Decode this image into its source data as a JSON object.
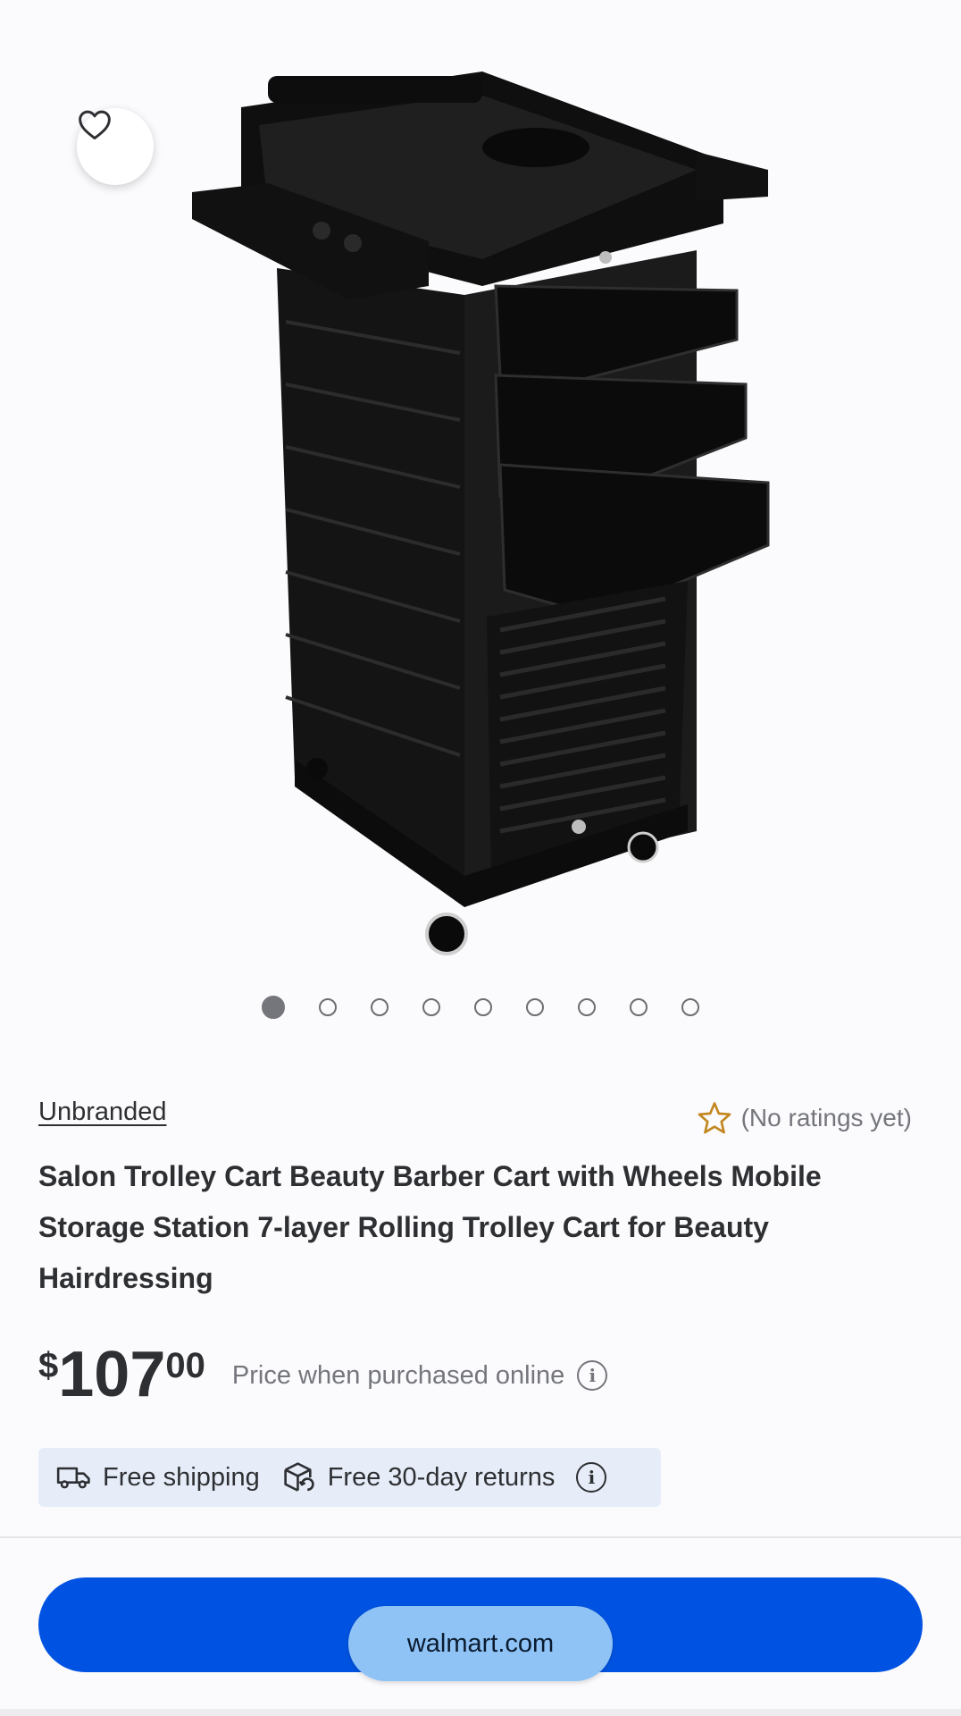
{
  "product": {
    "brand": "Unbranded",
    "rating_text": "(No ratings yet)",
    "title": "Salon Trolley Cart Beauty Barber Cart with Wheels Mobile Storage Station 7-layer Rolling Trolley Cart for Beauty Hairdressing",
    "price": {
      "currency": "$",
      "dollars": "107",
      "cents": "00",
      "note": "Price when purchased online"
    }
  },
  "gallery": {
    "image_count": 9,
    "active_index": 0
  },
  "shipping": {
    "free_shipping": "Free shipping",
    "returns": "Free 30-day returns"
  },
  "browser": {
    "url": "walmart.com"
  },
  "colors": {
    "primary": "#0053e2",
    "star": "#c2861f",
    "ship_bg": "#e6edf9"
  },
  "icons": {
    "favorite": "heart-icon",
    "rating": "star-icon",
    "shipping": "truck-icon",
    "returns": "return-box-icon",
    "info": "info-icon"
  }
}
